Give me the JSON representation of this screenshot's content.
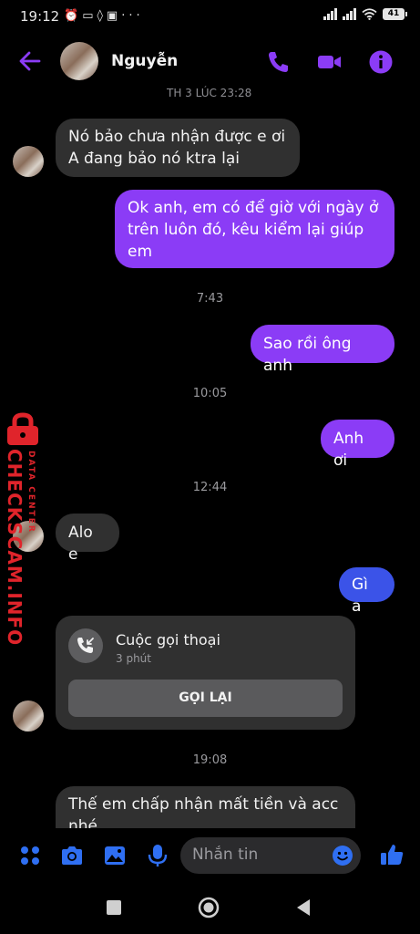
{
  "status_bar": {
    "time": "19:12",
    "battery": "41"
  },
  "header": {
    "contact_name": "Nguyễn"
  },
  "top_partial_date": "TH 3 LÚC 23:28",
  "messages": [
    {
      "text": "Nó bảo chưa nhận được e ơi\nA đang bảo nó ktra lại"
    },
    {
      "text": "Ok anh, em có để giờ với ngày ở trên luôn đó, kêu kiểm lại giúp em"
    },
    {
      "text": "Sao rồi ông anh"
    },
    {
      "text": "Anh ơi"
    },
    {
      "text": "Alo e"
    },
    {
      "text": "Gì a"
    },
    {
      "text": "Thế em chấp nhận mất tiền và acc nhé"
    }
  ],
  "timestamps": [
    "7:43",
    "10:05",
    "12:44",
    "19:08"
  ],
  "call_card": {
    "title": "Cuộc gọi thoại",
    "duration": "3 phút",
    "button": "GỌI LẠI"
  },
  "composer": {
    "placeholder": "Nhắn tin"
  },
  "watermark": {
    "brand": "CHECKSCAM.INFO",
    "tag": "DATA CENTER"
  },
  "colors": {
    "accent": "#8b3cf6",
    "outgoing_purple": "#8b3cf6",
    "outgoing_blue": "#3b53e8",
    "incoming": "#303030",
    "icon_blue": "#2f6ff2",
    "watermark": "#e0242b"
  }
}
